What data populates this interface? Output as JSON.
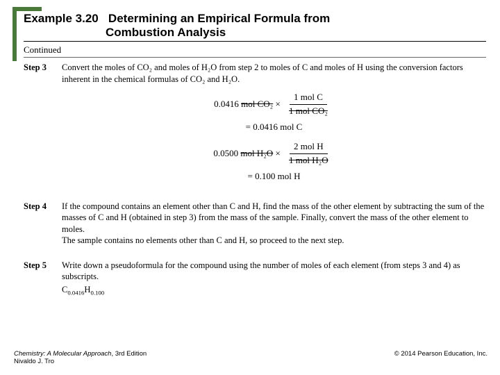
{
  "header": {
    "example_label": "Example 3.20",
    "title_line1": "Determining an Empirical Formula from",
    "title_line2": "Combustion Analysis",
    "continued": "Continued"
  },
  "steps": {
    "s3": {
      "label": "Step 3",
      "text": "Convert the moles of CO₂ and moles of H₂O from step 2 to moles of C and moles of H using the conversion factors inherent in the chemical formulas of CO₂ and H₂O.",
      "eq1_lhs_val": "0.0416",
      "eq1_lhs_unit": "mol CO₂",
      "eq1_frac_num": "1 mol C",
      "eq1_frac_den": "1 mol CO₂",
      "eq1_result": "= 0.0416 mol C",
      "eq2_lhs_val": "0.0500",
      "eq2_lhs_unit": "mol H₂O",
      "eq2_frac_num": "2 mol H",
      "eq2_frac_den": "1 mol H₂O",
      "eq2_result": "= 0.100 mol H"
    },
    "s4": {
      "label": "Step 4",
      "text": "If the compound contains an element other than C and H, find the mass of the other element by subtracting the sum of the masses of C and H (obtained in step 3) from the mass of the sample. Finally, convert the mass of the other element to moles.",
      "text2": "The sample contains no elements other than C and H, so proceed to the next step."
    },
    "s5": {
      "label": "Step 5",
      "text": "Write down a pseudoformula for the compound using the number of moles of each element (from steps 3 and 4) as subscripts.",
      "formula_c": "C",
      "formula_c_sub": "0.0416",
      "formula_h": "H",
      "formula_h_sub": "0.100"
    }
  },
  "footer": {
    "book": "Chemistry: A Molecular Approach",
    "edition": ", 3rd Edition",
    "author": "Nivaldo J. Tro",
    "copyright": "© 2014 Pearson Education, Inc."
  }
}
